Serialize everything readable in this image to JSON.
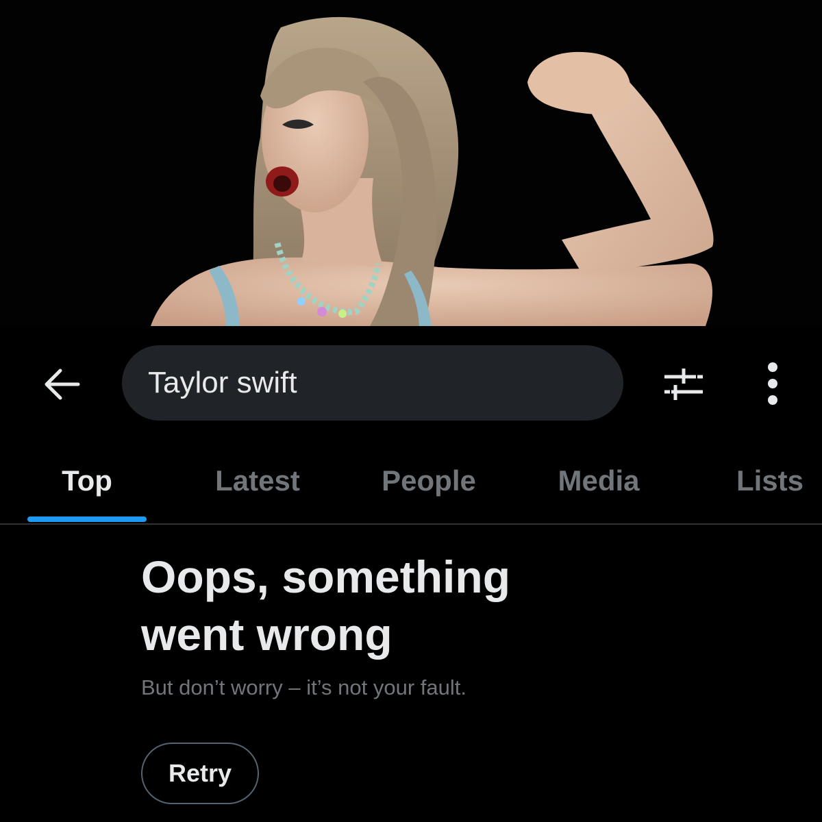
{
  "header_image": {
    "icon": "photo-performer-flexing"
  },
  "search_bar": {
    "back_icon": "arrow-left-icon",
    "query": "Taylor swift",
    "filter_icon": "sliders-icon",
    "more_icon": "more-vertical-icon"
  },
  "tabs": [
    {
      "label": "Top",
      "active": true
    },
    {
      "label": "Latest",
      "active": false
    },
    {
      "label": "People",
      "active": false
    },
    {
      "label": "Media",
      "active": false
    },
    {
      "label": "Lists",
      "active": false
    }
  ],
  "error": {
    "title": "Oops, something went wrong",
    "message": "But don’t worry – it’s not your fault.",
    "retry_label": "Retry"
  },
  "colors": {
    "background": "#000000",
    "search_field": "#202327",
    "accent": "#1d9bf0",
    "primary_text": "#e7e9ea",
    "secondary_text": "#71767b",
    "divider": "#2f3336"
  }
}
